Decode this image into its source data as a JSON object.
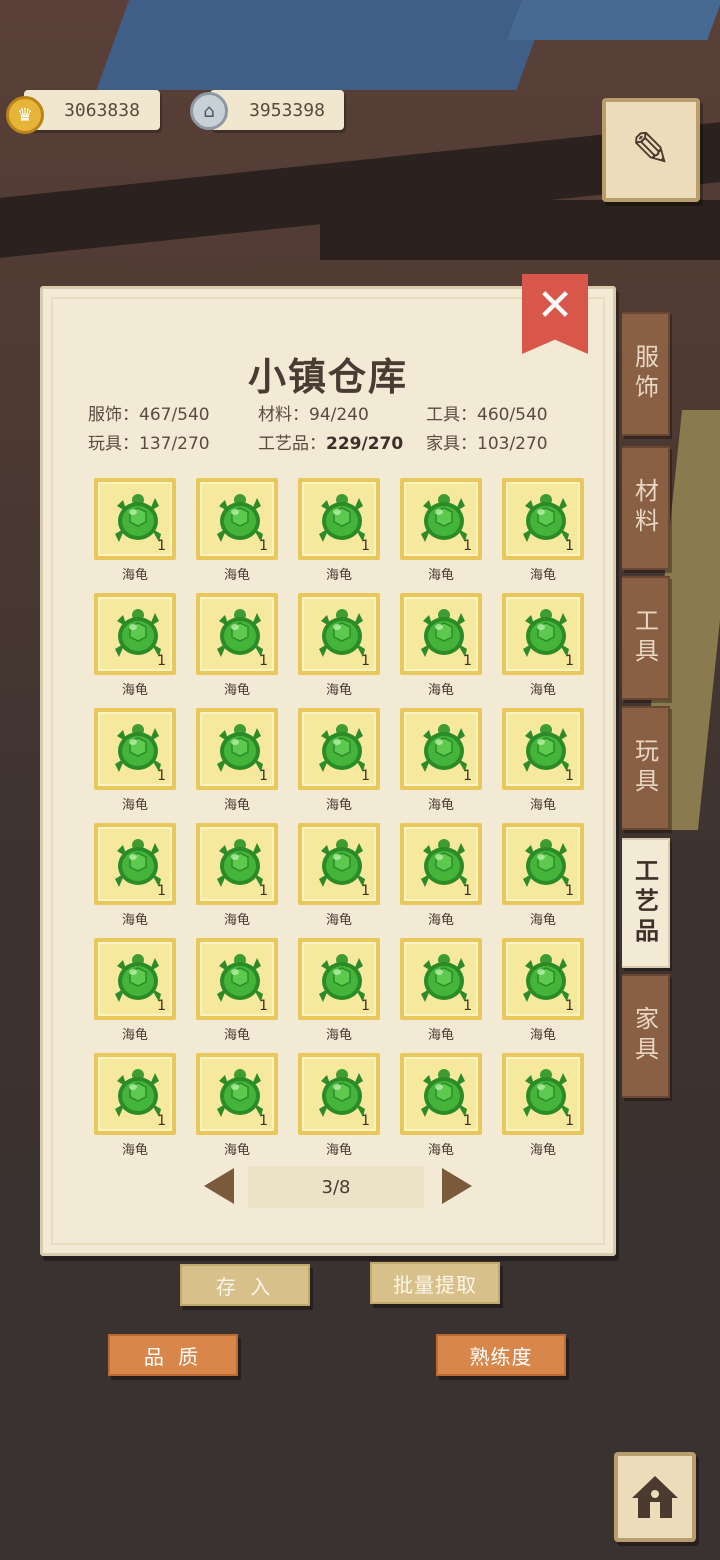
{
  "currencies": {
    "gold": {
      "value": "3063838",
      "icon": "gold-crown-coin-icon",
      "color": "#e7b43a"
    },
    "silver": {
      "value": "3953398",
      "icon": "silver-house-coin-icon",
      "color": "#c7cfd7"
    }
  },
  "panel": {
    "title": "小镇仓库",
    "close_icon": "close-icon",
    "stats": [
      {
        "label": "服饰：",
        "value": "467/540"
      },
      {
        "label": "材料：",
        "value": "94/240"
      },
      {
        "label": "工具：",
        "value": "460/540"
      },
      {
        "label": "玩具：",
        "value": "137/270"
      },
      {
        "label": "工艺品：",
        "value": "229/270"
      },
      {
        "label": "家具：",
        "value": "103/270"
      }
    ]
  },
  "items": [
    {
      "name": "海龟",
      "count": "1"
    },
    {
      "name": "海龟",
      "count": "1"
    },
    {
      "name": "海龟",
      "count": "1"
    },
    {
      "name": "海龟",
      "count": "1"
    },
    {
      "name": "海龟",
      "count": "1"
    },
    {
      "name": "海龟",
      "count": "1"
    },
    {
      "name": "海龟",
      "count": "1"
    },
    {
      "name": "海龟",
      "count": "1"
    },
    {
      "name": "海龟",
      "count": "1"
    },
    {
      "name": "海龟",
      "count": "1"
    },
    {
      "name": "海龟",
      "count": "1"
    },
    {
      "name": "海龟",
      "count": "1"
    },
    {
      "name": "海龟",
      "count": "1"
    },
    {
      "name": "海龟",
      "count": "1"
    },
    {
      "name": "海龟",
      "count": "1"
    },
    {
      "name": "海龟",
      "count": "1"
    },
    {
      "name": "海龟",
      "count": "1"
    },
    {
      "name": "海龟",
      "count": "1"
    },
    {
      "name": "海龟",
      "count": "1"
    },
    {
      "name": "海龟",
      "count": "1"
    },
    {
      "name": "海龟",
      "count": "1"
    },
    {
      "name": "海龟",
      "count": "1"
    },
    {
      "name": "海龟",
      "count": "1"
    },
    {
      "name": "海龟",
      "count": "1"
    },
    {
      "name": "海龟",
      "count": "1"
    },
    {
      "name": "海龟",
      "count": "1"
    },
    {
      "name": "海龟",
      "count": "1"
    },
    {
      "name": "海龟",
      "count": "1"
    },
    {
      "name": "海龟",
      "count": "1"
    },
    {
      "name": "海龟",
      "count": "1"
    }
  ],
  "pager": {
    "label": "3/8"
  },
  "tabs": [
    {
      "label": "服饰",
      "active": false
    },
    {
      "label": "材料",
      "active": false
    },
    {
      "label": "工具",
      "active": false
    },
    {
      "label": "玩具",
      "active": false
    },
    {
      "label": "工艺品",
      "active": true
    },
    {
      "label": "家具",
      "active": false
    }
  ],
  "buttons": {
    "store": "存 入",
    "batch_extract": "批量提取",
    "quality": "品 质",
    "proficiency": "熟练度"
  },
  "icons": {
    "map": "map-quill-icon",
    "home": "home-icon",
    "item": "sea-turtle-icon"
  }
}
